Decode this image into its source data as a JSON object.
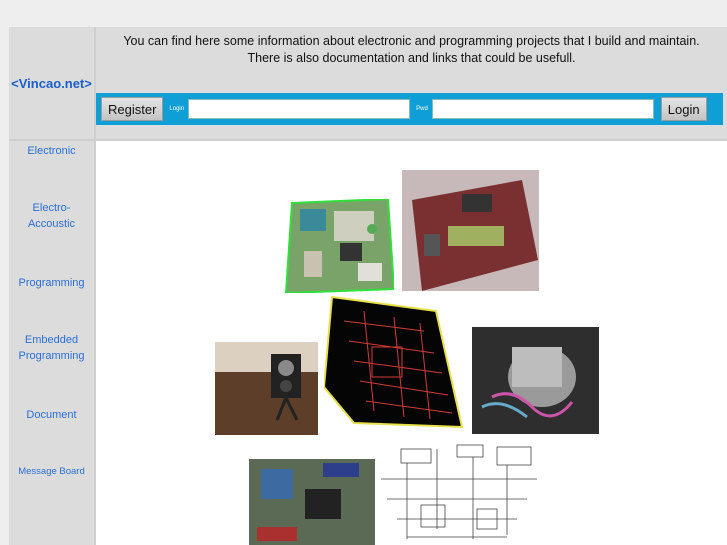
{
  "header": {
    "logo": "<Vincao.net>",
    "intro_line1": "You can find here some information about electronic and programming projects that I build and maintain.",
    "intro_line2": "There is also documentation and links that could be usefull."
  },
  "login": {
    "register_label": "Register",
    "login_label": "Login",
    "login_placeholder": "",
    "pwd_label": "Pwd",
    "pwd_placeholder": "",
    "submit_label": "Login"
  },
  "sidebar": {
    "items": [
      {
        "label": "Electronic"
      },
      {
        "label": "Electro-\nAccoustic"
      },
      {
        "label": "Programming"
      },
      {
        "label": "Embedded\nProgramming"
      },
      {
        "label": "Document"
      },
      {
        "label": "Message Board"
      }
    ]
  },
  "colors": {
    "bar": "#0f9fd6",
    "link": "#2a6fd8",
    "logo": "#1a5fd0"
  }
}
